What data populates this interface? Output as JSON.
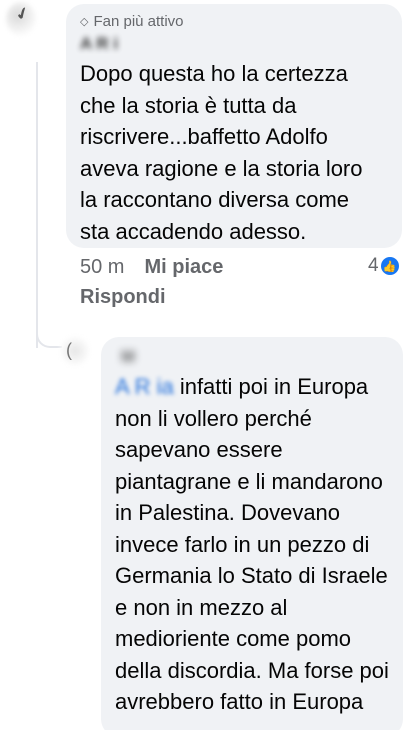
{
  "comment": {
    "badge": "Fan più attivo",
    "badge_icon": "diamond-icon",
    "author": "A    R    i ",
    "text": "Dopo questa ho la certezza\nche la storia è tutta da\nriscrivere...baffetto Adolfo\naveva ragione e la storia loro\nla raccontano diversa come\nsta accadendo adesso.",
    "time": "50 m",
    "like_label": "Mi piace",
    "reply_label": "Rispondi",
    "reaction_count": "4",
    "reaction_icon": "like-icon"
  },
  "reply": {
    "author": "M      ",
    "mention": "A    R   ia",
    "text": " infatti poi in Europa non li vollero perché sapevano essere piantagrane e li mandarono in Palestina. Dovevano invece farlo in un pezzo di Germania lo Stato di Israele e non in mezzo al medioriente come pomo della discordia. Ma forse poi avrebbero fatto in Europa"
  },
  "colors": {
    "bubble": "#f0f2f5",
    "text": "#050505",
    "secondary": "#65676b",
    "mention": "#216fdb",
    "like": "#1877f2"
  }
}
